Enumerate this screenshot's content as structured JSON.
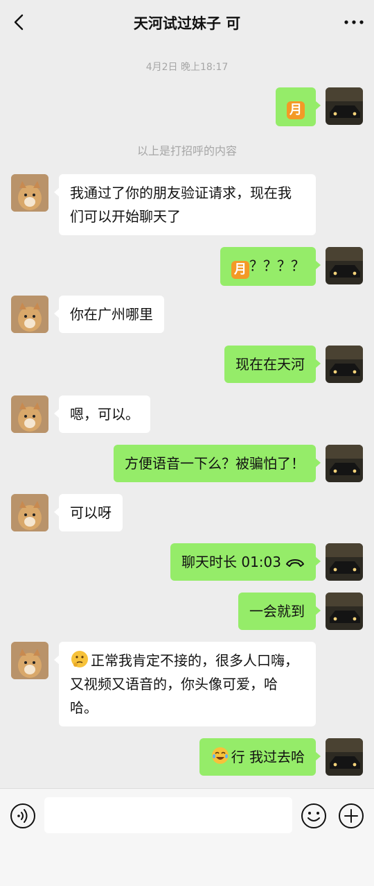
{
  "header": {
    "title": "天河试过妹子 可",
    "back_icon": "chevron-left-icon",
    "more_icon": "more-dots-icon"
  },
  "chat": {
    "timestamp": "4月2日 晚上18:17",
    "system_notice": "以上是打招呼的内容",
    "messages": [
      {
        "from": "me",
        "type": "emoji",
        "emoji": "月"
      },
      {
        "from": "them",
        "text": "我通过了你的朋友验证请求，现在我们可以开始聊天了"
      },
      {
        "from": "me",
        "emoji": "月",
        "text": "？？？？"
      },
      {
        "from": "them",
        "text": "你在广州哪里"
      },
      {
        "from": "me",
        "text": "现在在天河"
      },
      {
        "from": "them",
        "text": "嗯，可以。"
      },
      {
        "from": "me",
        "text": "方便语音一下么？被骗怕了！"
      },
      {
        "from": "them",
        "text": "可以呀"
      },
      {
        "from": "me",
        "type": "call",
        "text": "聊天时长 01:03",
        "icon": "phone-hangup-icon"
      },
      {
        "from": "me",
        "text": "一会就到"
      },
      {
        "from": "them",
        "emoji_icon": "thinking-face-icon",
        "text": "正常我肯定不接的，很多人口嗨，又视频又语音的，你头像可爱，哈哈。"
      },
      {
        "from": "me",
        "emoji_icon": "laughing-tears-face-icon",
        "text": "行 我过去哈"
      }
    ]
  },
  "input_bar": {
    "voice_icon": "voice-icon",
    "emoji_icon": "smiley-icon",
    "plus_icon": "plus-circle-icon",
    "input_value": ""
  },
  "colors": {
    "background": "#ededed",
    "my_bubble": "#95ec69",
    "their_bubble": "#ffffff",
    "meta_text": "#a6a6a6"
  }
}
